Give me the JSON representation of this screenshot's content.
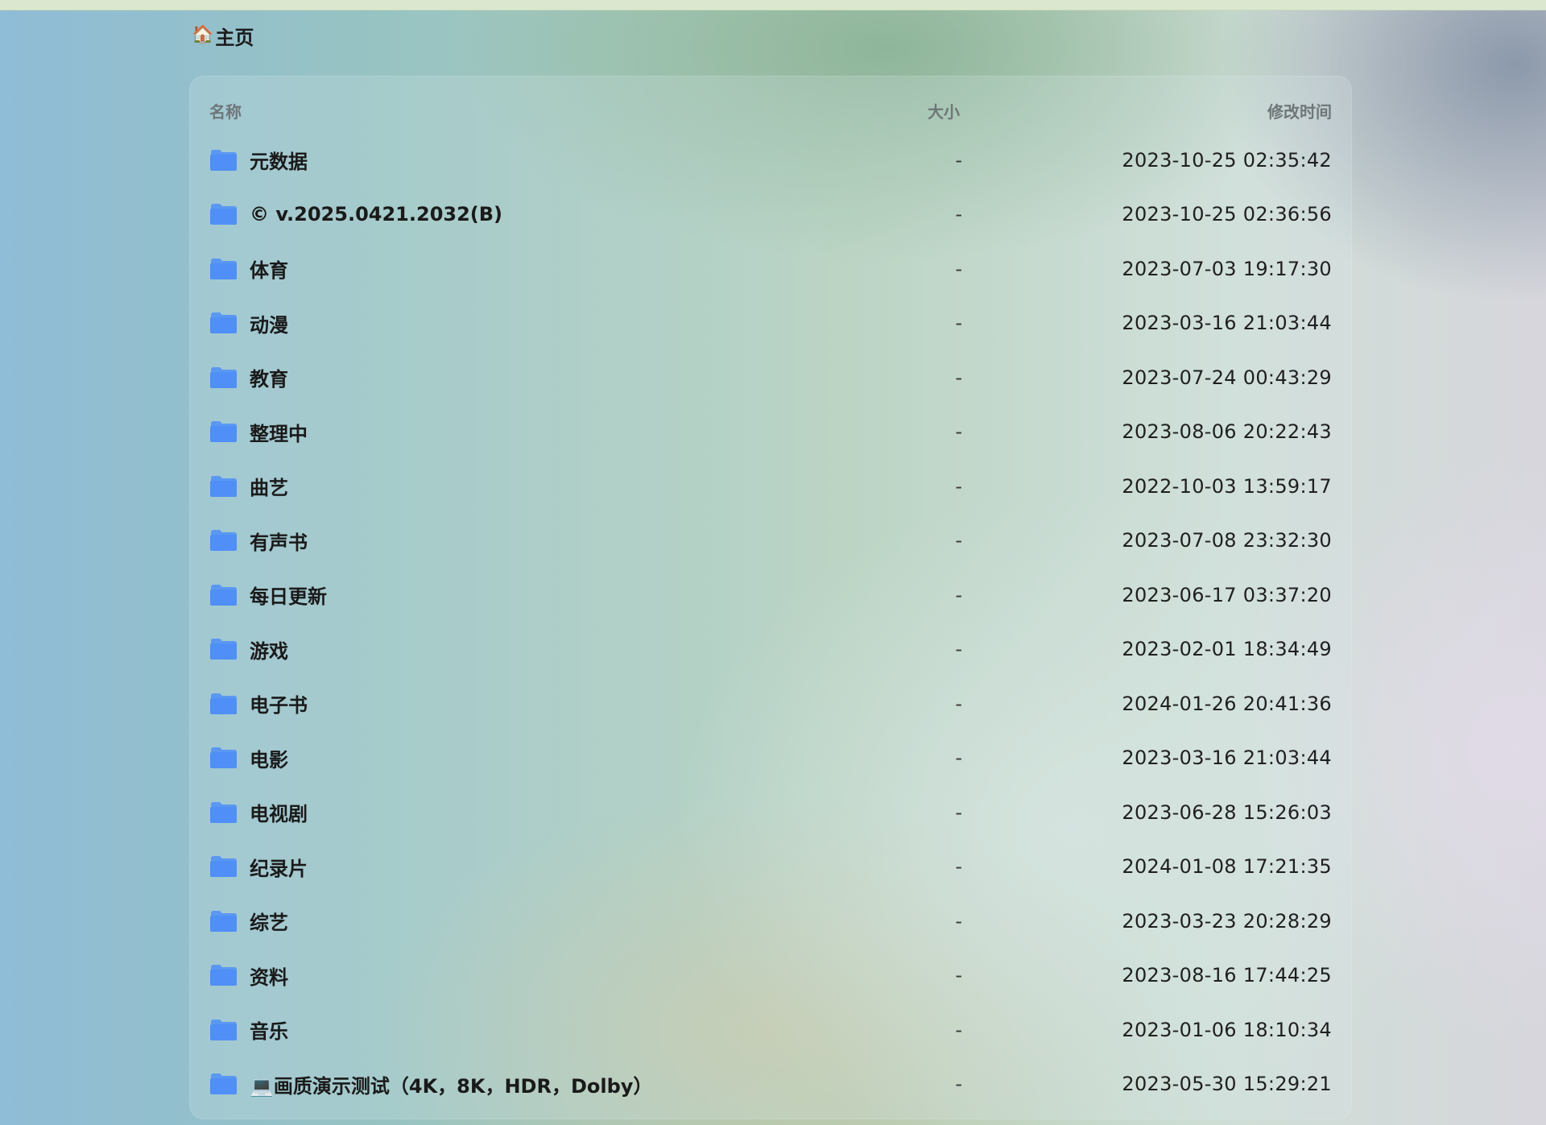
{
  "breadcrumb": {
    "home_icon": "🏠",
    "label": "主页"
  },
  "table": {
    "headers": {
      "name": "名称",
      "size": "大小",
      "modified": "修改时间"
    },
    "folder_color": "#4f8ff7",
    "rows": [
      {
        "name": "元数据",
        "size": "-",
        "modified": "2023-10-25 02:35:42"
      },
      {
        "name": "© v.2025.0421.2032(B)",
        "size": "-",
        "modified": "2023-10-25 02:36:56"
      },
      {
        "name": "体育",
        "size": "-",
        "modified": "2023-07-03 19:17:30"
      },
      {
        "name": "动漫",
        "size": "-",
        "modified": "2023-03-16 21:03:44"
      },
      {
        "name": "教育",
        "size": "-",
        "modified": "2023-07-24 00:43:29"
      },
      {
        "name": "整理中",
        "size": "-",
        "modified": "2023-08-06 20:22:43"
      },
      {
        "name": "曲艺",
        "size": "-",
        "modified": "2022-10-03 13:59:17"
      },
      {
        "name": "有声书",
        "size": "-",
        "modified": "2023-07-08 23:32:30"
      },
      {
        "name": "每日更新",
        "size": "-",
        "modified": "2023-06-17 03:37:20"
      },
      {
        "name": "游戏",
        "size": "-",
        "modified": "2023-02-01 18:34:49"
      },
      {
        "name": "电子书",
        "size": "-",
        "modified": "2024-01-26 20:41:36"
      },
      {
        "name": "电影",
        "size": "-",
        "modified": "2023-03-16 21:03:44"
      },
      {
        "name": "电视剧",
        "size": "-",
        "modified": "2023-06-28 15:26:03"
      },
      {
        "name": "纪录片",
        "size": "-",
        "modified": "2024-01-08 17:21:35"
      },
      {
        "name": "综艺",
        "size": "-",
        "modified": "2023-03-23 20:28:29"
      },
      {
        "name": "资料",
        "size": "-",
        "modified": "2023-08-16 17:44:25"
      },
      {
        "name": "音乐",
        "size": "-",
        "modified": "2023-01-06 18:10:34"
      },
      {
        "name": "💻画质演示测试（4K，8K，HDR，Dolby）",
        "size": "-",
        "modified": "2023-05-30 15:29:21"
      }
    ]
  }
}
